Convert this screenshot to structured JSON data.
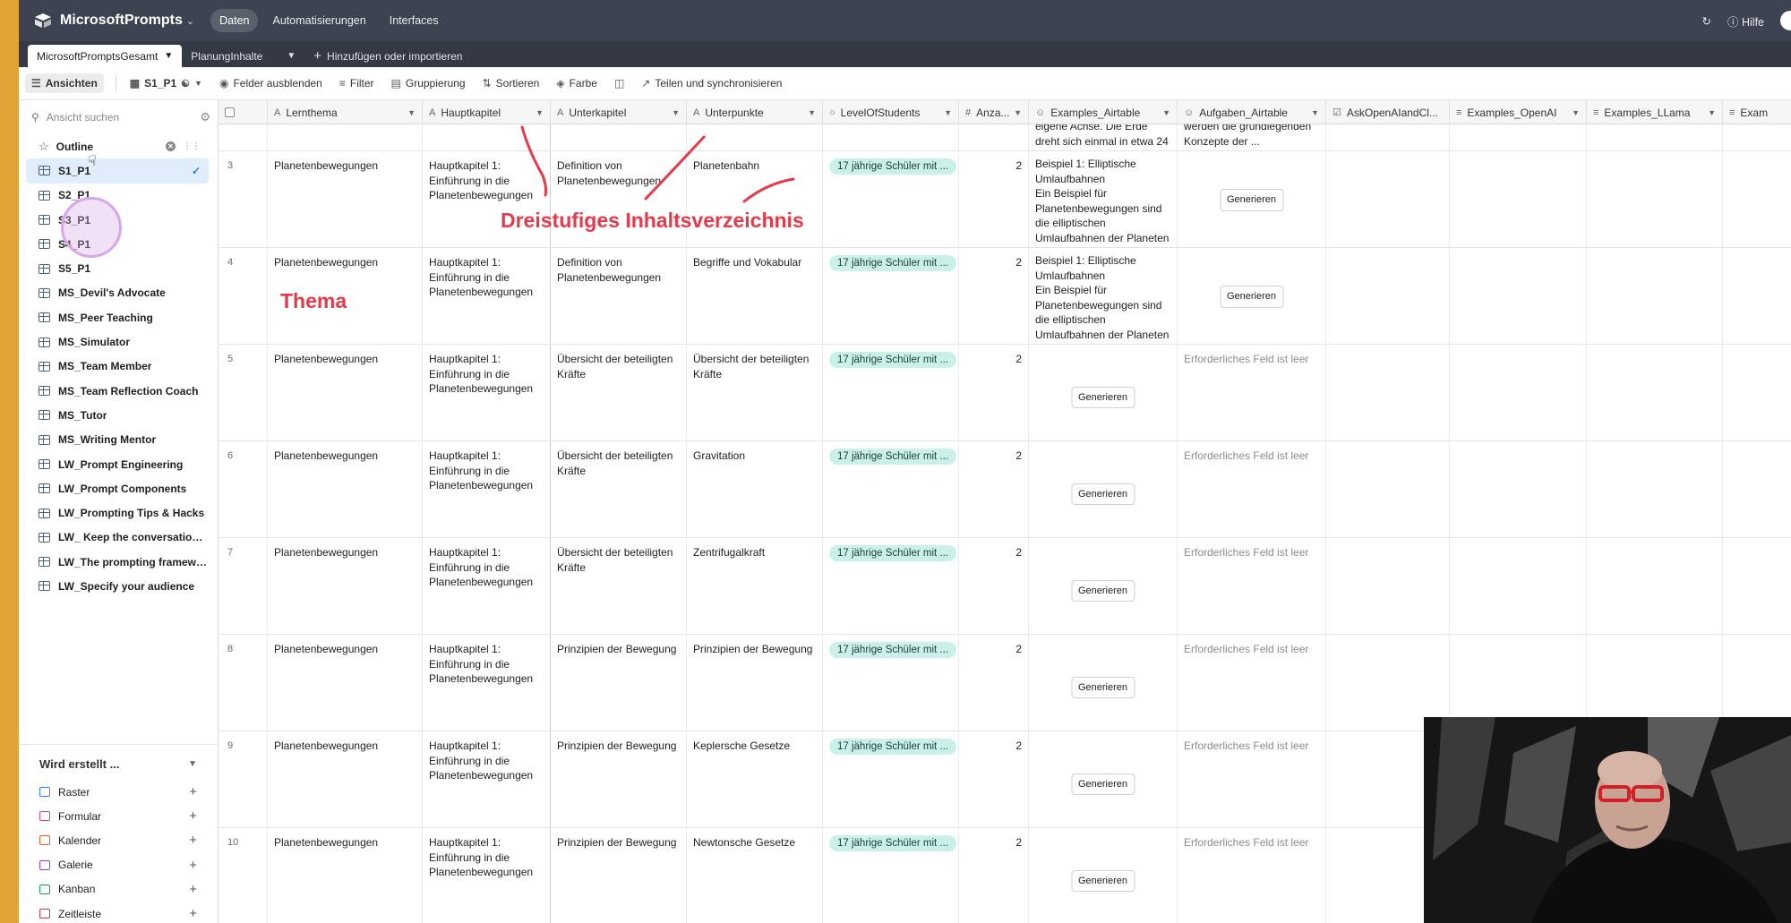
{
  "topbar": {
    "app_name": "MicrosoftPrompts",
    "nav": [
      "Daten",
      "Automatisierungen",
      "Interfaces"
    ],
    "help": "Hilfe"
  },
  "tabbar": {
    "tables": [
      "MicrosoftPromptsGesamt",
      "PlanungInhalte"
    ],
    "add_label": "Hinzufügen oder importieren"
  },
  "viewbar": {
    "views_label": "Ansichten",
    "current_view": "S1_P1",
    "hide_fields": "Felder ausblenden",
    "filter": "Filter",
    "group": "Gruppierung",
    "sort": "Sortieren",
    "color": "Farbe",
    "share": "Teilen und synchronisieren"
  },
  "sidebar": {
    "search_placeholder": "Ansicht suchen",
    "views": [
      "Outline",
      "S1_P1",
      "S2_P1",
      "S3_P1",
      "S4_P1",
      "S5_P1",
      "MS_Devil's Advocate",
      "MS_Peer Teaching",
      "MS_Simulator",
      "MS_Team Member",
      "MS_Team Reflection Coach",
      "MS_Tutor",
      "MS_Writing Mentor",
      "LW_Prompt Engineering",
      "LW_Prompt Components",
      "LW_Prompting Tips & Hacks",
      "LW_ Keep the conversation on...",
      "LW_The prompting framework...",
      "LW_Specify your audience"
    ],
    "create_title": "Wird erstellt ...",
    "create_items": [
      "Raster",
      "Formular",
      "Kalender",
      "Galerie",
      "Kanban",
      "Zeitleiste"
    ]
  },
  "grid": {
    "columns": [
      "Lernthema",
      "Hauptkapitel",
      "Unterkapitel",
      "Unterpunkte",
      "LevelOfStudents",
      "Anza...",
      "Examples_Airtable",
      "Aufgaben_Airtable",
      "AskOpenAIandCl...",
      "Examples_OpenAI",
      "Examples_LLama",
      "Exam"
    ],
    "partial_row": {
      "examples": "eigene Achse. Die Erde dreht sich einmal in etwa 24 ...",
      "aufgaben": "werden die grundlegenden Konzepte der ..."
    },
    "button_label": "Generieren",
    "empty_label": "Erforderliches Feld ist leer",
    "rows": [
      {
        "num": "3",
        "lernthema": "Planetenbewegungen",
        "hauptkapitel": "Hauptkapitel 1: Einführung in die Planetenbewegungen",
        "unterkapitel": "Definition von Planetenbewegungen",
        "unterpunkte": "Planetenbahn",
        "level": "17 jährige Schüler mit ...",
        "anzahl": "2",
        "examples": "Beispiel 1: Elliptische Umlaufbahnen\nEin Beispiel für Planetenbewegungen sind die elliptischen Umlaufbahnen der Planeten um die Sonne.",
        "aufgaben_button": true
      },
      {
        "num": "4",
        "lernthema": "Planetenbewegungen",
        "hauptkapitel": "Hauptkapitel 1: Einführung in die Planetenbewegungen",
        "unterkapitel": "Definition von Planetenbewegungen",
        "unterpunkte": "Begriffe und Vokabular",
        "level": "17 jährige Schüler mit ...",
        "anzahl": "2",
        "examples": "Beispiel 1: Elliptische Umlaufbahnen\nEin Beispiel für Planetenbewegungen sind die elliptischen Umlaufbahnen der Planeten um die Sonne.",
        "aufgaben_button": true
      },
      {
        "num": "5",
        "lernthema": "Planetenbewegungen",
        "hauptkapitel": "Hauptkapitel 1: Einführung in die Planetenbewegungen",
        "unterkapitel": "Übersicht der beteiligten Kräfte",
        "unterpunkte": "Übersicht der beteiligten Kräfte",
        "level": "17 jährige Schüler mit ...",
        "anzahl": "2",
        "examples": "",
        "aufgaben_button": false
      },
      {
        "num": "6",
        "lernthema": "Planetenbewegungen",
        "hauptkapitel": "Hauptkapitel 1: Einführung in die Planetenbewegungen",
        "unterkapitel": "Übersicht der beteiligten Kräfte",
        "unterpunkte": "Gravitation",
        "level": "17 jährige Schüler mit ...",
        "anzahl": "2",
        "examples": "",
        "aufgaben_button": false
      },
      {
        "num": "7",
        "lernthema": "Planetenbewegungen",
        "hauptkapitel": "Hauptkapitel 1: Einführung in die Planetenbewegungen",
        "unterkapitel": "Übersicht der beteiligten Kräfte",
        "unterpunkte": "Zentrifugalkraft",
        "level": "17 jährige Schüler mit ...",
        "anzahl": "2",
        "examples": "",
        "aufgaben_button": false
      },
      {
        "num": "8",
        "lernthema": "Planetenbewegungen",
        "hauptkapitel": "Hauptkapitel 1: Einführung in die Planetenbewegungen",
        "unterkapitel": "Prinzipien der Bewegung",
        "unterpunkte": "Prinzipien der Bewegung",
        "level": "17 jährige Schüler mit ...",
        "anzahl": "2",
        "examples": "",
        "aufgaben_button": false
      },
      {
        "num": "9",
        "lernthema": "Planetenbewegungen",
        "hauptkapitel": "Hauptkapitel 1: Einführung in die Planetenbewegungen",
        "unterkapitel": "Prinzipien der Bewegung",
        "unterpunkte": "Keplersche Gesetze",
        "level": "17 jährige Schüler mit ...",
        "anzahl": "2",
        "examples": "",
        "aufgaben_button": false
      },
      {
        "num": "10",
        "lernthema": "Planetenbewegungen",
        "hauptkapitel": "Hauptkapitel 1: Einführung in die Planetenbewegungen",
        "unterkapitel": "Prinzipien der Bewegung",
        "unterpunkte": "Newtonsche Gesetze",
        "level": "17 jährige Schüler mit ...",
        "anzahl": "2",
        "examples": "",
        "aufgaben_button": false
      }
    ]
  },
  "annotations": {
    "thema": "Thema",
    "toc": "Dreistufiges Inhaltsverzeichnis",
    "color": "#e33b4b"
  }
}
